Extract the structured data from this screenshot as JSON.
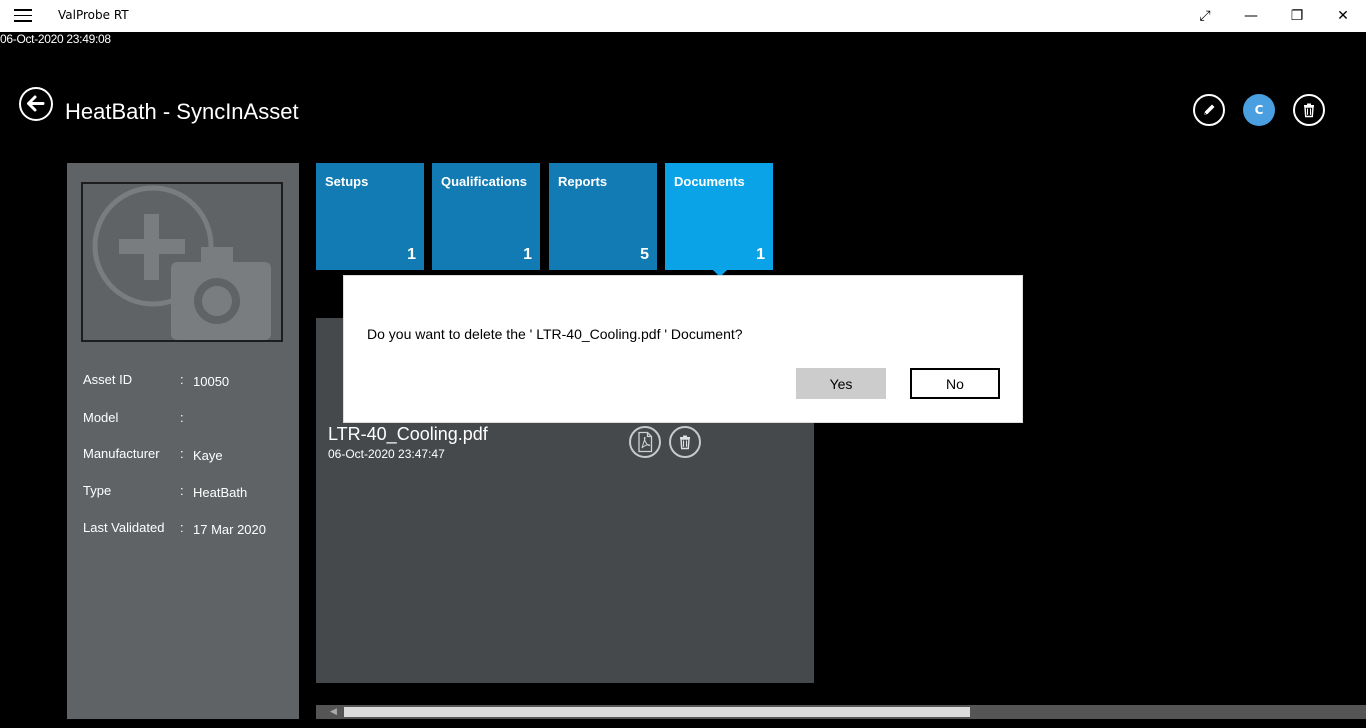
{
  "app": {
    "title": "ValProbe RT",
    "timestamp": "06-Oct-2020 23:49:08"
  },
  "window_controls": {
    "fullscreen": "⤢",
    "minimize": "—",
    "restore": "❐",
    "close": "✕"
  },
  "header": {
    "title": "HeatBath - SyncInAsset",
    "avatar_initial": "C"
  },
  "asset": {
    "fields": [
      {
        "label": "Asset ID",
        "value": "10050"
      },
      {
        "label": "Model",
        "value": ""
      },
      {
        "label": "Manufacturer",
        "value": "Kaye"
      },
      {
        "label": "Type",
        "value": "HeatBath"
      },
      {
        "label": "Last Validated",
        "value": "17 Mar 2020"
      }
    ],
    "separator": ":"
  },
  "tiles": [
    {
      "label": "Setups",
      "count": "1"
    },
    {
      "label": "Qualifications",
      "count": "1"
    },
    {
      "label": "Reports",
      "count": "5"
    },
    {
      "label": "Documents",
      "count": "1"
    }
  ],
  "document": {
    "name": "LTR-40_Cooling.pdf",
    "date": "06-Oct-2020 23:47:47"
  },
  "dialog": {
    "message": "Do you want to delete the ' LTR-40_Cooling.pdf ' Document?",
    "yes_label": "Yes",
    "no_label": "No"
  },
  "colors": {
    "tile": "#137bb4",
    "tile_active": "#0aa3e8",
    "panel": "#5f6366",
    "doc_area": "#45494c",
    "avatar": "#4a9fe0"
  }
}
